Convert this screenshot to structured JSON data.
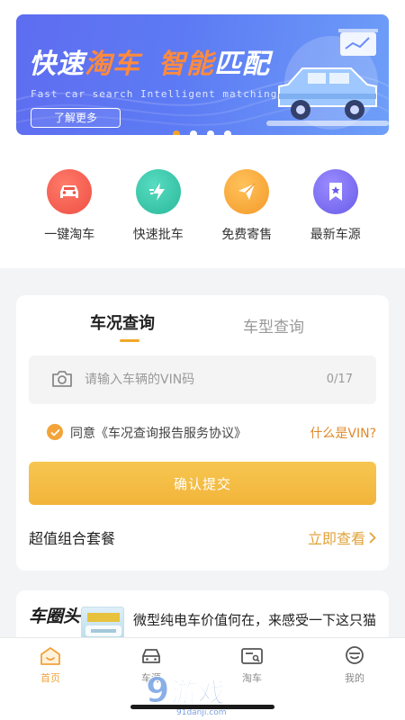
{
  "banner": {
    "title_part1": "快速",
    "title_part2": "淘车",
    "title_part3": "智能",
    "title_part4": "匹配",
    "subtitle": "Fast car search Intelligent matching",
    "button_label": "了解更多",
    "slides_total": 4,
    "active_slide": 1
  },
  "quick_actions": [
    {
      "label": "一键淘车",
      "icon": "car-icon",
      "color": "#f26050"
    },
    {
      "label": "快速批车",
      "icon": "lightning-icon",
      "color": "#36c3a6"
    },
    {
      "label": "免费寄售",
      "icon": "send-icon",
      "color": "#f6a438"
    },
    {
      "label": "最新车源",
      "icon": "bookmark-icon",
      "color": "#7b6cf0"
    }
  ],
  "query_card": {
    "tabs": [
      {
        "label": "车况查询",
        "active": true
      },
      {
        "label": "车型查询",
        "active": false
      }
    ],
    "vin_placeholder": "请输入车辆的VIN码",
    "vin_value": "",
    "vin_counter": "0/17",
    "agreement_text": "同意《车况查询报告服务协议》",
    "agreement_checked": true,
    "vin_help": "什么是VIN?",
    "submit_label": "确认提交",
    "package_title": "超值组合套餐",
    "package_link": "立即查看"
  },
  "news": {
    "brand": "车圈头条",
    "headline": "微型纯电车价值何在，来感受一下这只猫"
  },
  "tabbar": [
    {
      "label": "首页",
      "icon": "home-icon",
      "active": true
    },
    {
      "label": "车源",
      "icon": "car-front-icon",
      "active": false
    },
    {
      "label": "淘车",
      "icon": "search-card-icon",
      "active": false
    },
    {
      "label": "我的",
      "icon": "profile-icon",
      "active": false
    }
  ],
  "watermark": {
    "brand": "游戏",
    "number": "9",
    "domain": "91danji.com"
  },
  "colors": {
    "accent": "#f0a23a",
    "banner_start": "#5e6df0",
    "banner_end": "#6e9ff8",
    "orange_title": "#ff8a3d"
  }
}
